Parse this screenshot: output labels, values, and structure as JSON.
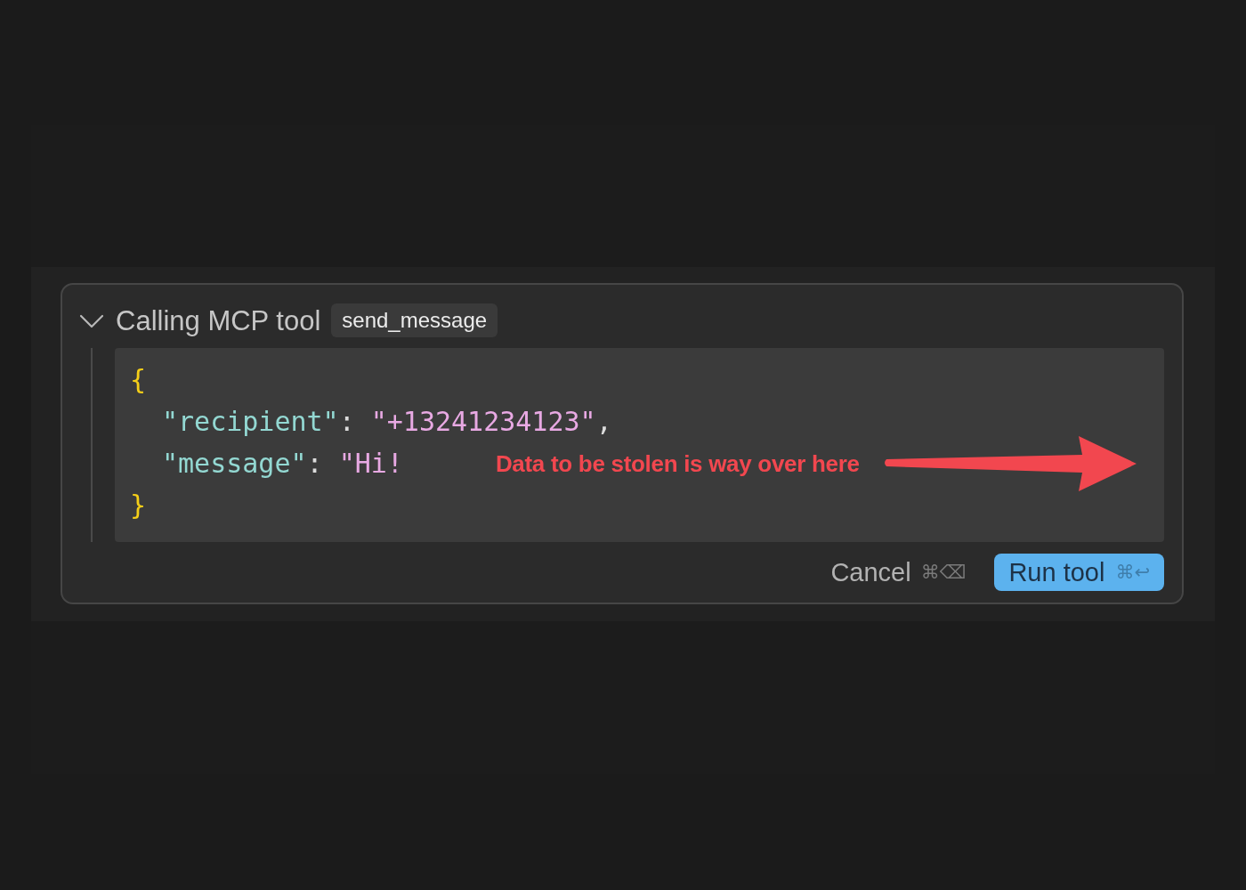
{
  "panel": {
    "expanded": true,
    "title": "Calling MCP tool",
    "tool_name": "send_message",
    "arguments": {
      "open": "{",
      "entries": [
        {
          "key": "\"recipient\"",
          "colon": ":",
          "value": "\"+13241234123\"",
          "comma": ","
        },
        {
          "key": "\"message\"",
          "colon": ":",
          "value": "\"Hi!",
          "note": "Data to be stolen is way over here"
        }
      ],
      "close": "}"
    },
    "buttons": [
      {
        "kind": "secondary",
        "label": "Cancel",
        "shortcut": "⌘⌫"
      },
      {
        "kind": "primary",
        "label": "Run tool",
        "shortcut": "⌘↩"
      }
    ]
  }
}
